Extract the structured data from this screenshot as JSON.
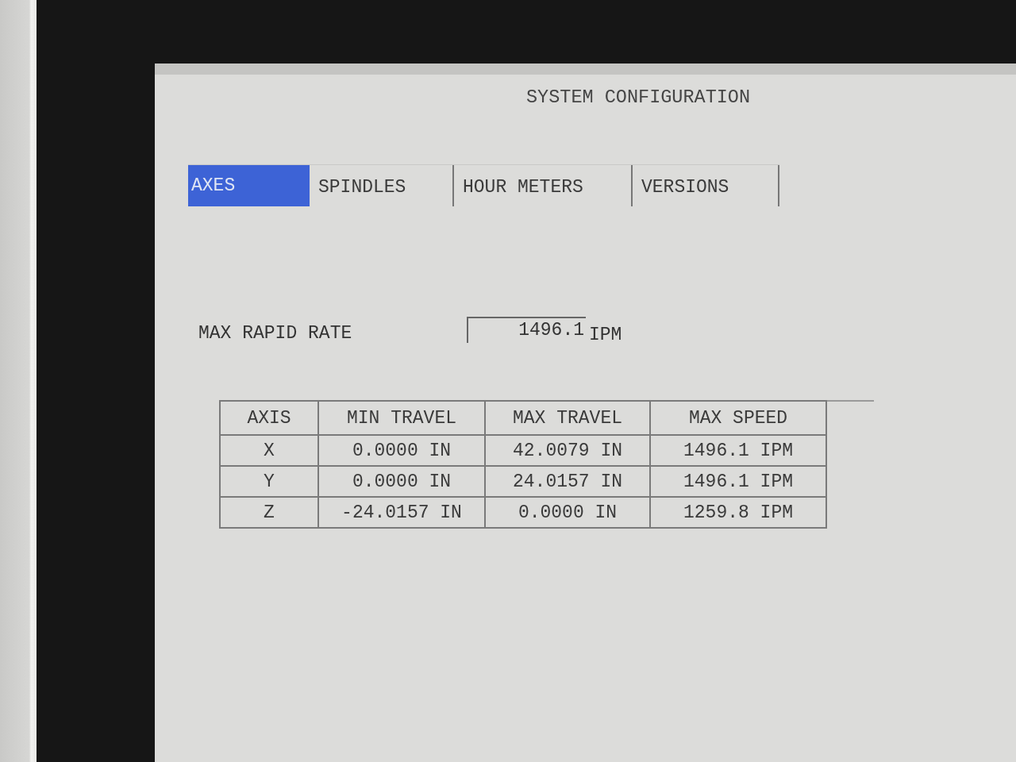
{
  "screen": {
    "title": "SYSTEM CONFIGURATION"
  },
  "tabs": [
    {
      "label": "AXES",
      "selected": true
    },
    {
      "label": "SPINDLES",
      "selected": false
    },
    {
      "label": "HOUR METERS",
      "selected": false
    },
    {
      "label": "VERSIONS",
      "selected": false
    }
  ],
  "max_rapid_rate": {
    "label": "MAX RAPID RATE",
    "value": "1496.1",
    "unit": "IPM"
  },
  "table": {
    "columns": [
      "AXIS",
      "MIN TRAVEL",
      "MAX TRAVEL",
      "MAX SPEED"
    ],
    "rows": [
      [
        "X",
        "0.0000 IN",
        "42.0079 IN",
        "1496.1 IPM"
      ],
      [
        "Y",
        "0.0000 IN",
        "24.0157 IN",
        "1496.1 IPM"
      ],
      [
        "Z",
        "-24.0157 IN",
        "0.0000 IN",
        "1259.8 IPM"
      ]
    ]
  }
}
